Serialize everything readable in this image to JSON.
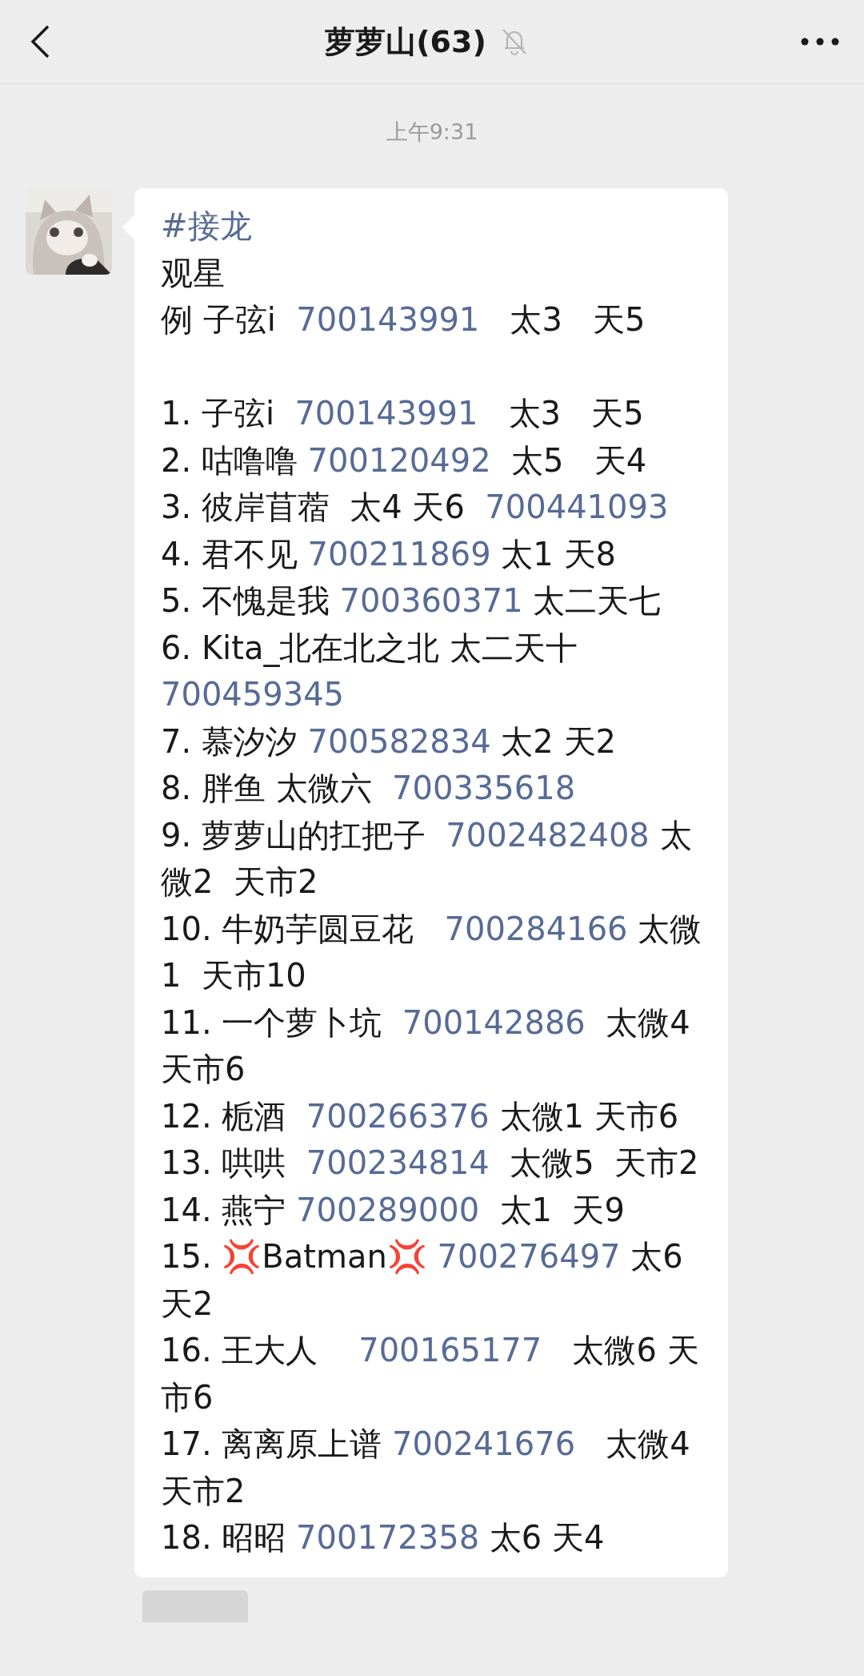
{
  "header": {
    "title": "萝萝山(63)",
    "muted": true
  },
  "timestamp": "上午9:31",
  "message": {
    "hashtag": "#接龙",
    "title": "观星",
    "example": {
      "parts": [
        {
          "kind": "text",
          "text": "例 子弦i  "
        },
        {
          "kind": "link",
          "text": "700143991"
        },
        {
          "kind": "text",
          "text": "   太3   天5"
        }
      ]
    },
    "entries": [
      {
        "parts": [
          {
            "kind": "text",
            "text": "1. 子弦i  "
          },
          {
            "kind": "link",
            "text": "700143991"
          },
          {
            "kind": "text",
            "text": "   太3   天5"
          }
        ]
      },
      {
        "parts": [
          {
            "kind": "text",
            "text": "2. 咕噜噜 "
          },
          {
            "kind": "link",
            "text": "700120492"
          },
          {
            "kind": "text",
            "text": "  太5   天4"
          }
        ]
      },
      {
        "parts": [
          {
            "kind": "text",
            "text": "3. 彼岸苜蓿  太4 天6  "
          },
          {
            "kind": "link",
            "text": "700441093"
          }
        ]
      },
      {
        "parts": [
          {
            "kind": "text",
            "text": "4. 君不见 "
          },
          {
            "kind": "link",
            "text": "700211869"
          },
          {
            "kind": "text",
            "text": " 太1 天8"
          }
        ]
      },
      {
        "parts": [
          {
            "kind": "text",
            "text": "5. 不愧是我 "
          },
          {
            "kind": "link",
            "text": "700360371"
          },
          {
            "kind": "text",
            "text": " 太二天七"
          }
        ]
      },
      {
        "parts": [
          {
            "kind": "text",
            "text": "6. Kita_北在北之北 太二天十 "
          },
          {
            "kind": "link",
            "text": "700459345"
          }
        ]
      },
      {
        "parts": [
          {
            "kind": "text",
            "text": "7. 慕汐汐 "
          },
          {
            "kind": "link",
            "text": "700582834"
          },
          {
            "kind": "text",
            "text": " 太2 天2"
          }
        ]
      },
      {
        "parts": [
          {
            "kind": "text",
            "text": "8. 胖鱼 太微六  "
          },
          {
            "kind": "link",
            "text": "700335618"
          }
        ]
      },
      {
        "parts": [
          {
            "kind": "text",
            "text": "9. 萝萝山的扛把子  "
          },
          {
            "kind": "link",
            "text": "7002482408"
          },
          {
            "kind": "text",
            "text": " 太微2  天市2"
          }
        ]
      },
      {
        "parts": [
          {
            "kind": "text",
            "text": "10. 牛奶芋圆豆花   "
          },
          {
            "kind": "link",
            "text": "700284166"
          },
          {
            "kind": "text",
            "text": " 太微1  天市10"
          }
        ]
      },
      {
        "parts": [
          {
            "kind": "text",
            "text": "11. 一个萝卜坑  "
          },
          {
            "kind": "link",
            "text": "700142886"
          },
          {
            "kind": "text",
            "text": "  太微4  天市6"
          }
        ]
      },
      {
        "parts": [
          {
            "kind": "text",
            "text": "12. 栀酒  "
          },
          {
            "kind": "link",
            "text": "700266376"
          },
          {
            "kind": "text",
            "text": " 太微1 天市6"
          }
        ]
      },
      {
        "parts": [
          {
            "kind": "text",
            "text": "13. 哄哄  "
          },
          {
            "kind": "link",
            "text": "700234814"
          },
          {
            "kind": "text",
            "text": "  太微5  天市2"
          }
        ]
      },
      {
        "parts": [
          {
            "kind": "text",
            "text": "14. 燕宁 "
          },
          {
            "kind": "link",
            "text": "700289000"
          },
          {
            "kind": "text",
            "text": "  太1  天9"
          }
        ]
      },
      {
        "parts": [
          {
            "kind": "text",
            "text": "15. 💢Batman💢 "
          },
          {
            "kind": "link",
            "text": "700276497"
          },
          {
            "kind": "text",
            "text": " 太6  天2"
          }
        ]
      },
      {
        "parts": [
          {
            "kind": "text",
            "text": "16. 王大人    "
          },
          {
            "kind": "link",
            "text": "700165177"
          },
          {
            "kind": "text",
            "text": "   太微6 天市6"
          }
        ]
      },
      {
        "parts": [
          {
            "kind": "text",
            "text": "17. 离离原上谱 "
          },
          {
            "kind": "link",
            "text": "700241676"
          },
          {
            "kind": "text",
            "text": "   太微4天市2"
          }
        ]
      },
      {
        "parts": [
          {
            "kind": "text",
            "text": "18. 昭昭 "
          },
          {
            "kind": "link",
            "text": "700172358"
          },
          {
            "kind": "text",
            "text": " 太6 天4"
          }
        ]
      }
    ]
  }
}
